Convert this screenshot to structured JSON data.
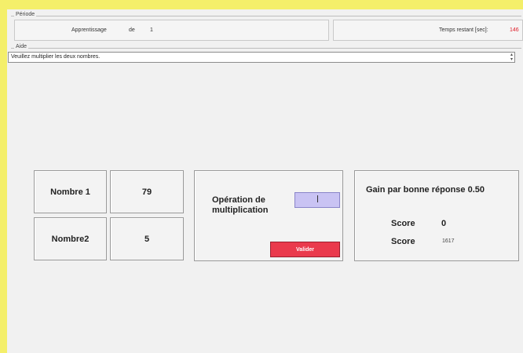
{
  "period": {
    "legend": "Période",
    "phase_label": "Apprentissage",
    "of_label": "de",
    "of_value": "1",
    "time_label": "Temps restant [sec]:",
    "time_value": "146"
  },
  "help": {
    "legend": "Aide",
    "text": "Veuillez multiplier les deux nombres."
  },
  "numbers": {
    "number1_label": "Nombre 1",
    "number1_value": "79",
    "number2_label": "Nombre2",
    "number2_value": "5"
  },
  "operation": {
    "label": "Opération de multiplication",
    "answer_value": "",
    "validate_label": "Valider",
    "validate_color": "#ea3a4d"
  },
  "scoreboard": {
    "gain_label": "Gain par bonne réponse 0.50",
    "score_label_1": "Score",
    "score_value_1": "0",
    "score_label_2": "Score",
    "score_value_2": "1617"
  },
  "colors": {
    "window_border": "#f4ef6a",
    "time_value": "#e0202b",
    "answer_bg": "#c9c3f3"
  }
}
